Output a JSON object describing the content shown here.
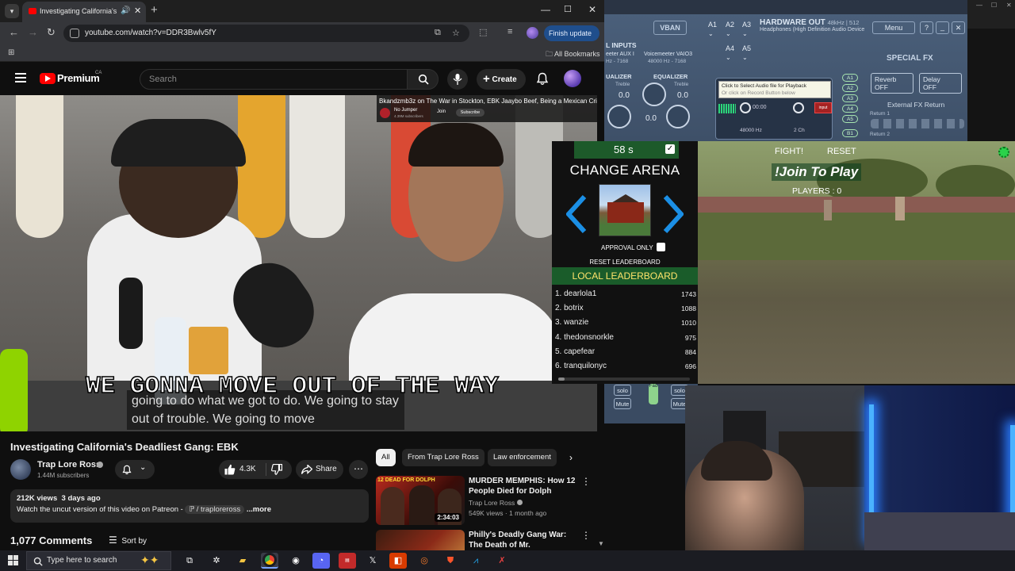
{
  "browser": {
    "tab_title": "Investigating California's De",
    "url": "youtube.com/watch?v=DDR3Bwlv5fY",
    "finish_update": "Finish update",
    "all_bookmarks": "All Bookmarks"
  },
  "youtube": {
    "brand": "Premium",
    "region": "CA",
    "search_placeholder": "Search",
    "create_label": "Create",
    "video": {
      "caption_big": "WE GONNA MOVE OUT OF THE WAY",
      "caption_cc": "going to do what we got to do. We going to stay out of trouble. We going to move",
      "overlay_title": "Bkandzmb3z on The War in Stockton, EBK Jaaybo Beef, Being a Mexican Crip",
      "overlay_channel": "No Jumper",
      "overlay_subs": "4.39M subscribers",
      "overlay_join": "Join",
      "overlay_subscribe": "Subscribe"
    },
    "title": "Investigating California's Deadliest Gang: EBK",
    "channel": {
      "name": "Trap Lore Ross",
      "subscribers": "1.44M subscribers"
    },
    "likes": "4.3K",
    "share_label": "Share",
    "description": {
      "views": "212K views",
      "age": "3 days ago",
      "text": "Watch the uncut version of this video on Patreon - ",
      "link": "/ traploreross",
      "more": "...more"
    },
    "comments_count": "1,077 Comments",
    "sort_label": "Sort by",
    "chips": [
      "All",
      "From Trap Lore Ross",
      "Law enforcement"
    ],
    "recommendations": [
      {
        "title": "MURDER MEMPHIS: How 12 People Died for Dolph",
        "channel": "Trap Lore Ross",
        "stats": "549K views · 1 month ago",
        "duration": "2:34:03",
        "thumb_text": "12 DEAD FOR DOLPH"
      },
      {
        "title": "Philly's Deadly Gang War: The Death of Mr. Disrespectful",
        "channel": "",
        "stats": "",
        "duration": "",
        "thumb_text": ""
      }
    ]
  },
  "voicemeeter": {
    "vban": "VBAN",
    "buses_a": [
      "A1",
      "A2",
      "A3",
      "A4",
      "A5"
    ],
    "hw_out_title": "HARDWARE OUT",
    "hw_out_meta": "48kHz | 512",
    "hw_out_device": "Headphones (High Definition Audio Device",
    "menu": "Menu",
    "help": "?",
    "inputs_label": "L INPUTS",
    "input1": "eeter AUX I",
    "input1_rate": "Hz - 7168",
    "input2": "Voicemeeter VAIO3",
    "input2_rate": "48000 Hz - 7168",
    "eq1": "UALIZER",
    "eq2": "EQUALIZER",
    "treble": "Treble",
    "zero": "0.0",
    "tooltip_line1": "Click to Select Audio file for Playback",
    "tooltip_line2": "Or click on Record Button below",
    "player_time": "00:00",
    "player_rate": "48000 Hz",
    "player_ch": "2 Ch",
    "player_input": "input",
    "bus_buttons": [
      "A1",
      "A2",
      "A3",
      "A4",
      "A5",
      "B1"
    ],
    "special_fx": "SPECIAL FX",
    "reverb": "Reverb",
    "reverb_state": "OFF",
    "delay": "Delay",
    "delay_state": "OFF",
    "external_fx": "External FX Return",
    "return1": "Return 1",
    "return2": "Return 2",
    "solo": "solo",
    "mute": "Mute",
    "fader": "Fad"
  },
  "arena": {
    "timer": "58 s",
    "title": "CHANGE ARENA",
    "approval": "APPROVAL ONLY",
    "reset_leaderboard": "RESET LEADERBOARD",
    "local_leaderboard": "LOCAL LEADERBOARD",
    "leaderboard": [
      {
        "rank": "1.",
        "name": "dearlola1",
        "score": "1743"
      },
      {
        "rank": "2.",
        "name": "botrix",
        "score": "1088"
      },
      {
        "rank": "3.",
        "name": "wanzie",
        "score": "1010"
      },
      {
        "rank": "4.",
        "name": "thedonsnorkle",
        "score": "975"
      },
      {
        "rank": "5.",
        "name": "capefear",
        "score": "884"
      },
      {
        "rank": "6.",
        "name": "tranquilonyc",
        "score": "696"
      }
    ]
  },
  "game": {
    "fight": "FIGHT!",
    "reset": "RESET",
    "join": "!Join To Play",
    "players": "PLAYERS : 0"
  },
  "taskbar": {
    "search_placeholder": "Type here to search",
    "apps": [
      "task-view",
      "slack",
      "file-explorer",
      "chrome",
      "obs",
      "discord",
      "stream-deck",
      "x-app",
      "office",
      "blender",
      "brave",
      "vscode",
      "app"
    ]
  },
  "colors": {
    "youtube_red": "#ff0000",
    "leaderboard_green": "#1a5c2a",
    "leaderboard_yellow": "#ffe36b",
    "voicemeeter_blue": "#4a5f7a"
  }
}
